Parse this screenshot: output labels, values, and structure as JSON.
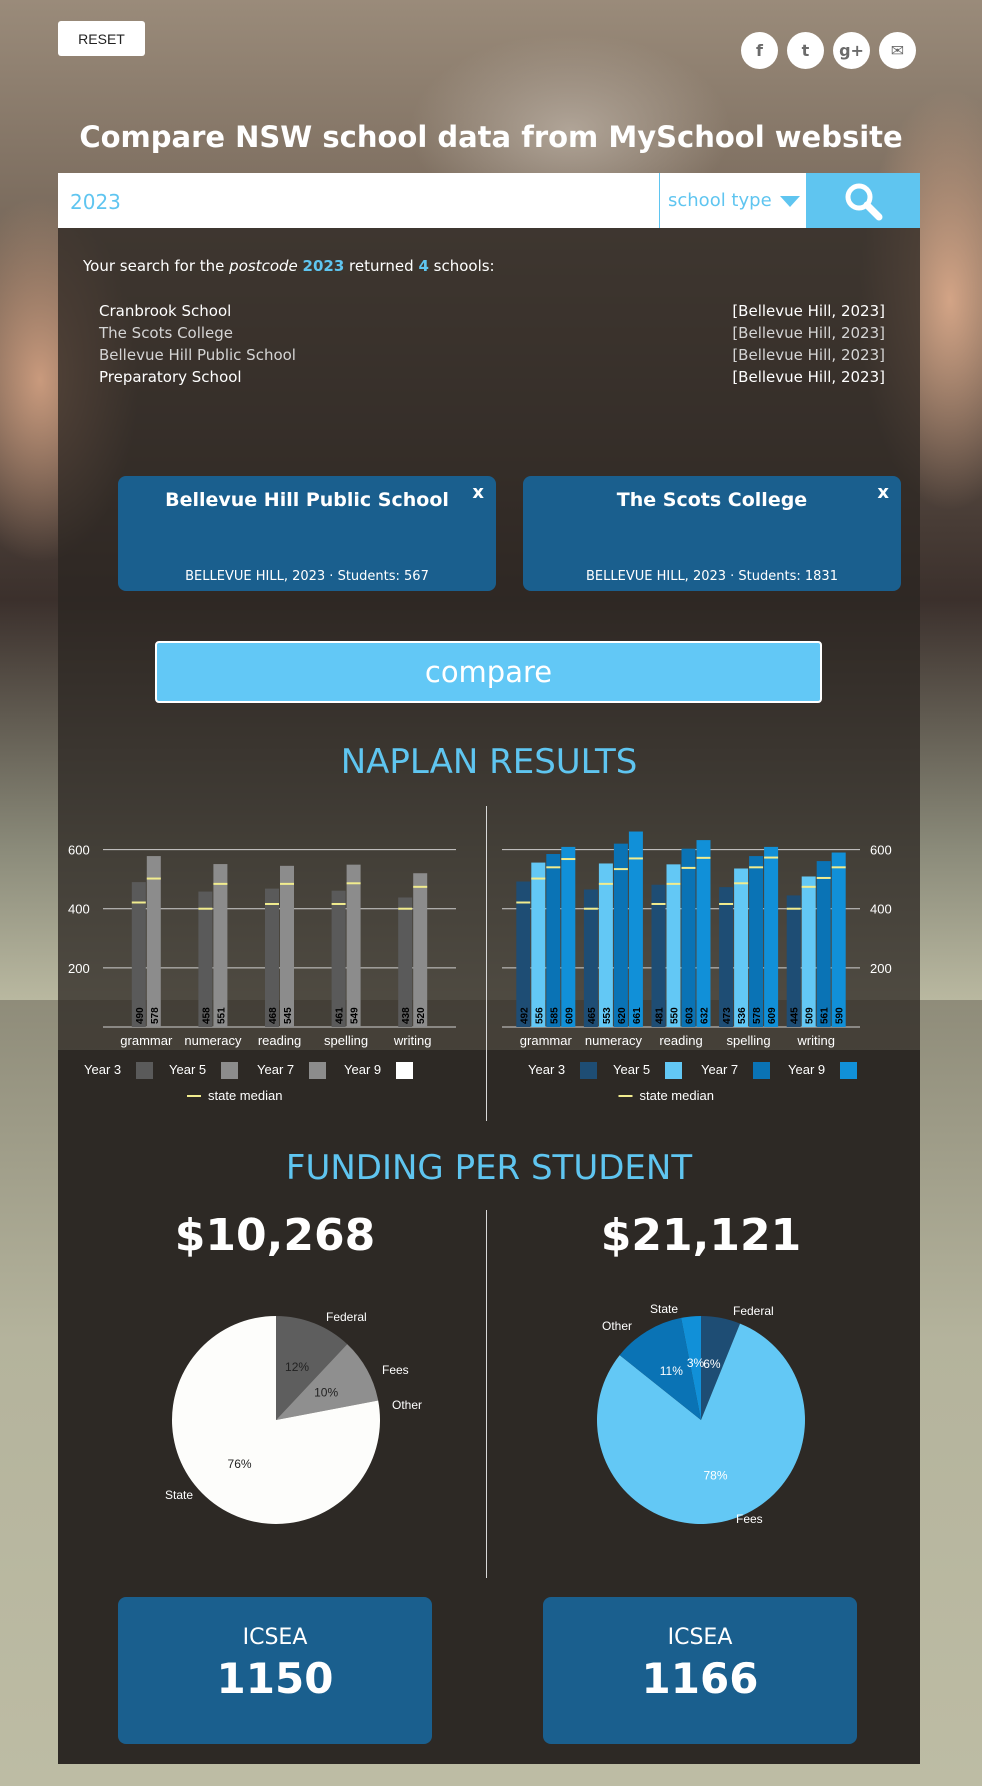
{
  "header": {
    "reset_label": "RESET",
    "title": "Compare NSW school data from MySchool website",
    "social": [
      {
        "icon": "facebook-icon",
        "glyph": "f"
      },
      {
        "icon": "twitter-icon",
        "glyph": "t"
      },
      {
        "icon": "google-plus-icon",
        "glyph": "g+"
      },
      {
        "icon": "mail-icon",
        "glyph": "✉"
      }
    ]
  },
  "search": {
    "query": "2023",
    "type_label": "school type"
  },
  "results": {
    "prefix": "Your search for the ",
    "field": "postcode",
    "value": "2023",
    "middle": " returned ",
    "count": "4",
    "suffix": " schools:",
    "items": [
      {
        "name": "Cranbrook School",
        "loc": "[Bellevue Hill, 2023]"
      },
      {
        "name": "The Scots College",
        "loc": "[Bellevue Hill, 2023]"
      },
      {
        "name": "Bellevue Hill Public School",
        "loc": "[Bellevue Hill, 2023]"
      },
      {
        "name": "Preparatory School",
        "loc": "[Bellevue Hill, 2023]"
      }
    ]
  },
  "selected": [
    {
      "name": "Bellevue Hill Public School",
      "meta": "BELLEVUE HILL, 2023 · Students: 567",
      "close": "x"
    },
    {
      "name": "The Scots College",
      "meta": "BELLEVUE HILL, 2023 · Students: 1831",
      "close": "x"
    }
  ],
  "compare_label": "compare",
  "naplan_title": "NAPLAN RESULTS",
  "funding_title": "FUNDING PER STUDENT",
  "funding": [
    {
      "amount": "$10,268"
    },
    {
      "amount": "$21,121"
    }
  ],
  "icsea": [
    {
      "label": "ICSEA",
      "value": "1150"
    },
    {
      "label": "ICSEA",
      "value": "1166"
    }
  ],
  "chart_data": [
    {
      "type": "bar",
      "categories": [
        "grammar",
        "numeracy",
        "reading",
        "spelling",
        "writing"
      ],
      "ylim": [
        0,
        700
      ],
      "yticks": [
        200,
        400,
        600
      ],
      "series": [
        {
          "name": "Year 3",
          "values": [
            490,
            458,
            468,
            461,
            438
          ],
          "color": "#5a5a5a"
        },
        {
          "name": "Year 5",
          "values": [
            578,
            551,
            545,
            549,
            520
          ],
          "color": "#8c8c8c"
        },
        {
          "name": "Year 7",
          "values": [],
          "color": "#8c8c8c"
        },
        {
          "name": "Year 9",
          "values": [],
          "color": "#ffffff"
        }
      ],
      "median_label": "state median",
      "median_color": "#f1ec8e",
      "medians": [
        [
          421,
          502
        ],
        [
          400,
          484
        ],
        [
          416,
          484
        ],
        [
          416,
          486
        ],
        [
          400,
          474
        ]
      ]
    },
    {
      "type": "bar",
      "categories": [
        "grammar",
        "numeracy",
        "reading",
        "spelling",
        "writing"
      ],
      "ylim": [
        0,
        700
      ],
      "yticks": [
        200,
        400,
        600
      ],
      "series": [
        {
          "name": "Year 3",
          "values": [
            492,
            465,
            481,
            473,
            445
          ],
          "color": "#1e4d74"
        },
        {
          "name": "Year 5",
          "values": [
            556,
            553,
            550,
            536,
            509
          ],
          "color": "#63c8f5"
        },
        {
          "name": "Year 7",
          "values": [
            585,
            620,
            603,
            578,
            561
          ],
          "color": "#0a73b5"
        },
        {
          "name": "Year 9",
          "values": [
            609,
            661,
            632,
            609,
            590
          ],
          "color": "#1190d8"
        }
      ],
      "median_label": "state median",
      "median_color": "#f1ec8e",
      "medians": [
        [
          421,
          502,
          540,
          568
        ],
        [
          400,
          484,
          534,
          570
        ],
        [
          416,
          484,
          538,
          572
        ],
        [
          416,
          486,
          540,
          573
        ],
        [
          400,
          474,
          504,
          540
        ]
      ]
    },
    {
      "type": "pie",
      "slices": [
        {
          "name": "Federal",
          "value": 12,
          "label": "12%",
          "color": "#5e5e5e"
        },
        {
          "name": "Fees",
          "value": 10,
          "label": "10%",
          "color": "#8f8f8f"
        },
        {
          "name": "Other",
          "value": 0,
          "label": "",
          "color": "#bbbbbb"
        },
        {
          "name": "State",
          "value": 78,
          "label": "76%",
          "color": "#fdfdfb"
        }
      ]
    },
    {
      "type": "pie",
      "slices": [
        {
          "name": "Federal",
          "value": 6,
          "label": "6%",
          "color": "#1e4d74"
        },
        {
          "name": "Fees",
          "value": 78,
          "label": "78%",
          "color": "#63c8f5"
        },
        {
          "name": "Other",
          "value": 11,
          "label": "11%",
          "color": "#0a73b5"
        },
        {
          "name": "State",
          "value": 3,
          "label": "3%",
          "color": "#1190d8"
        }
      ]
    }
  ]
}
